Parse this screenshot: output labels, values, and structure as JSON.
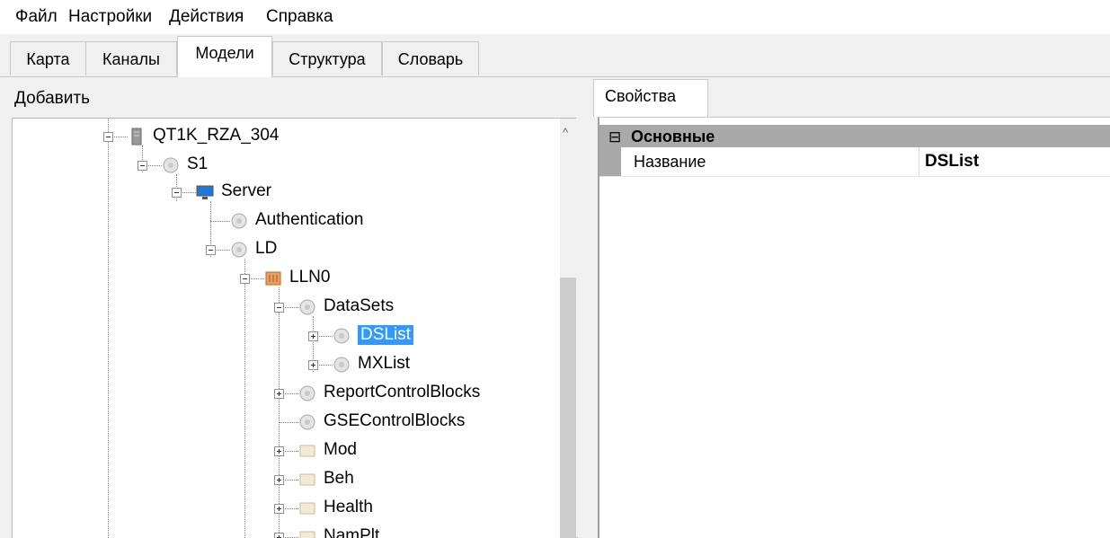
{
  "menu": {
    "file": "Файл",
    "settings": "Настройки",
    "actions": "Действия",
    "help": "Справка"
  },
  "tabs": {
    "map": "Карта",
    "channels": "Каналы",
    "models": "Модели",
    "structure": "Структура",
    "dictionary": "Словарь",
    "active": "models"
  },
  "left_panel": {
    "add_label": "Добавить"
  },
  "tree": {
    "nodes": [
      {
        "label": "QT1K_RZA_304",
        "icon": "device-icon",
        "expanded": true
      },
      {
        "label": "S1",
        "icon": "node-icon",
        "expanded": true
      },
      {
        "label": "Server",
        "icon": "monitor-icon",
        "expanded": true
      },
      {
        "label": "Authentication",
        "icon": "node-icon"
      },
      {
        "label": "LD",
        "icon": "node-icon",
        "expanded": true
      },
      {
        "label": "LLN0",
        "icon": "logical-node-icon",
        "expanded": true
      },
      {
        "label": "DataSets",
        "icon": "node-icon",
        "expanded": true
      },
      {
        "label": "DSList",
        "icon": "node-icon",
        "expanded": false,
        "selected": true
      },
      {
        "label": "MXList",
        "icon": "node-icon",
        "expanded": false
      },
      {
        "label": "ReportControlBlocks",
        "icon": "node-icon",
        "expanded": false
      },
      {
        "label": "GSEControlBlocks",
        "icon": "node-icon"
      },
      {
        "label": "Mod",
        "icon": "data-object-icon",
        "expanded": false
      },
      {
        "label": "Beh",
        "icon": "data-object-icon",
        "expanded": false
      },
      {
        "label": "Health",
        "icon": "data-object-icon",
        "expanded": false
      },
      {
        "label": "NamPlt",
        "icon": "data-object-icon",
        "expanded": false
      }
    ]
  },
  "properties": {
    "tab_label": "Свойства",
    "category": "Основные",
    "category_sign": "⊟",
    "rows": [
      {
        "name": "Название",
        "value": "DSList"
      }
    ]
  },
  "colors": {
    "selection": "#3399ff",
    "category_bg": "#a9a9a9"
  }
}
